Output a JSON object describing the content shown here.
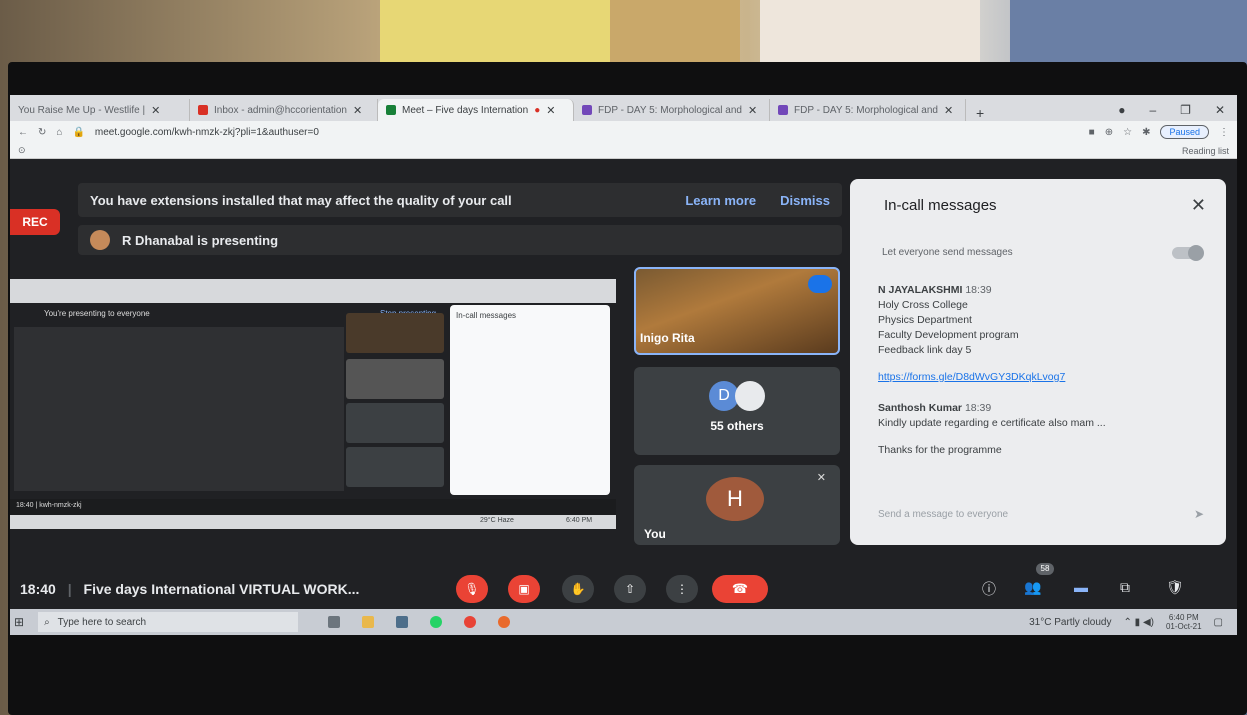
{
  "browser": {
    "tabs": [
      {
        "label": "You Raise Me Up - Westlife |",
        "color": "#ff0000"
      },
      {
        "label": "Inbox - admin@hccorientation",
        "color": "#d93025"
      },
      {
        "label": "Meet – Five days Internation",
        "color": "#188038"
      },
      {
        "label": "FDP - DAY 5: Morphological and",
        "color": "#7248b9"
      },
      {
        "label": "FDP - DAY 5: Morphological and",
        "color": "#7248b9"
      }
    ],
    "new_tab": "+",
    "url": "meet.google.com/kwh-nmzk-zkj?pli=1&authuser=0",
    "paused": "Paused",
    "reading_list": "Reading list"
  },
  "meet": {
    "rec": "REC",
    "notice": "You have extensions installed that may affect the quality of your call",
    "learn_more": "Learn more",
    "dismiss": "Dismiss",
    "presenting": "R Dhanabal is presenting",
    "tiles": {
      "inigo": "Inigo Rita",
      "others_count": "55 others",
      "others_initial": "D",
      "you_initial": "H",
      "you": "You"
    },
    "meeting_time": "18:40",
    "meeting_title": "Five days International VIRTUAL WORK...",
    "participants_badge": "58"
  },
  "shared_screen": {
    "presenting_text": "You're presenting to everyone",
    "stop_presenting": "Stop presenting",
    "chat_title": "In-call messages",
    "meeting_code": "18:40 | kwh-nmzk-zkj",
    "task_temp": "29°C Haze",
    "task_time": "6:40 PM"
  },
  "chat": {
    "title": "In-call messages",
    "toggle_label": "Let everyone send messages",
    "messages": [
      {
        "sender": "N JAYALAKSHMI",
        "time": "18:39",
        "lines": [
          "Holy Cross College",
          "Physics Department",
          "Faculty Development program",
          "Feedback link day 5"
        ],
        "link": "https://forms.gle/D8dWvGY3DKqkLvog7"
      },
      {
        "sender": "Santhosh Kumar",
        "time": "18:39",
        "lines": [
          "Kindly update regarding e certificate also mam ..."
        ]
      },
      {
        "sender": "",
        "time": "",
        "lines": [
          "Thanks for the programme"
        ]
      }
    ],
    "input_placeholder": "Send a message to everyone"
  },
  "taskbar": {
    "search": "Type here to search",
    "weather": "31°C Partly cloudy",
    "time": "6:40 PM",
    "date": "01-Oct-21"
  }
}
